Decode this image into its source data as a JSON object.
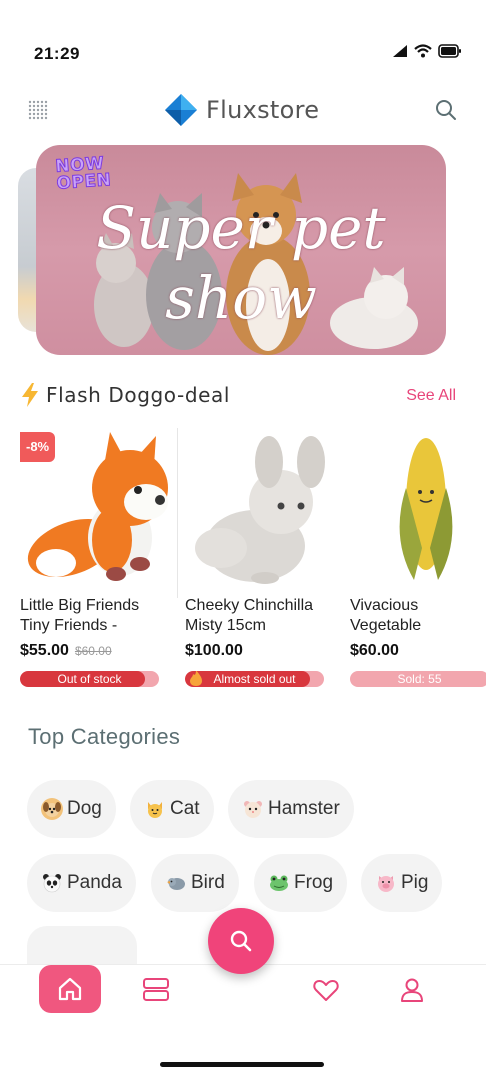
{
  "status_bar": {
    "time": "21:29"
  },
  "header": {
    "app_name": "Fluxstore"
  },
  "banner": {
    "tag_line1": "NOW",
    "tag_line2": "OPEN",
    "title_line1": "Super pet",
    "title_line2": "show"
  },
  "flash": {
    "icon": "lightning-icon",
    "title": "Flash Doggo-deal",
    "see_all": "See All"
  },
  "products": [
    {
      "name_line1": "Little Big Friends",
      "name_line2": "Tiny Friends -",
      "price": "$55.00",
      "old_price": "$60.00",
      "discount": "-8%",
      "stock_label": "Out of stock",
      "stock_fraction": 0.9
    },
    {
      "name_line1": "Cheeky Chinchilla",
      "name_line2": "Misty 15cm",
      "price": "$100.00",
      "stock_label": "Almost sold out",
      "stock_fraction": 0.9
    },
    {
      "name_line1": "Vivacious",
      "name_line2": "Vegetable",
      "price": "$60.00",
      "stock_label": "Sold: 55",
      "stock_fraction": 0.0
    }
  ],
  "categories": {
    "title": "Top Categories",
    "items": [
      {
        "label": "Dog",
        "icon": "dog-icon"
      },
      {
        "label": "Cat",
        "icon": "cat-icon"
      },
      {
        "label": "Hamster",
        "icon": "hamster-icon"
      },
      {
        "label": "Panda",
        "icon": "panda-icon"
      },
      {
        "label": "Bird",
        "icon": "bird-icon"
      },
      {
        "label": "Frog",
        "icon": "frog-icon"
      },
      {
        "label": "Pig",
        "icon": "pig-icon"
      }
    ]
  },
  "colors": {
    "accent": "#f0447a",
    "brand_text": "#555555",
    "sold_out": "#d8373e",
    "stock_track": "#f2a6ae"
  },
  "nav": {
    "items": [
      "home-icon",
      "categories-icon",
      "search-icon",
      "heart-icon",
      "user-icon"
    ]
  }
}
